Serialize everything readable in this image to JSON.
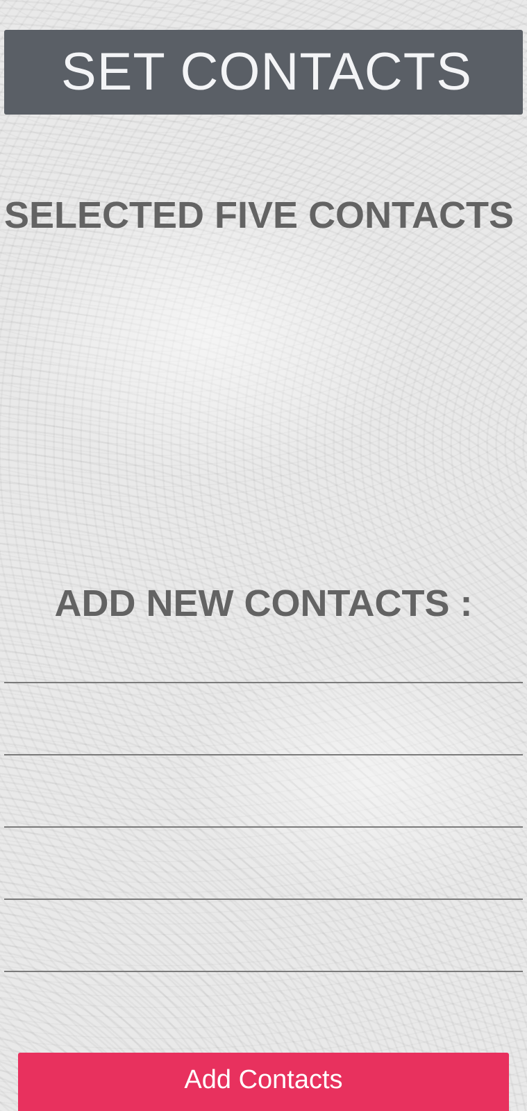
{
  "header": {
    "title": "SET CONTACTS"
  },
  "selected_section": {
    "heading": "SELECTED FIVE CONTACTS"
  },
  "add_section": {
    "heading": "ADD NEW CONTACTS :",
    "fields": [
      {
        "value": "",
        "placeholder": ""
      },
      {
        "value": "",
        "placeholder": ""
      },
      {
        "value": "",
        "placeholder": ""
      },
      {
        "value": "",
        "placeholder": ""
      },
      {
        "value": "",
        "placeholder": ""
      }
    ]
  },
  "actions": {
    "add_button_label": "Add Contacts"
  },
  "colors": {
    "header_bg": "#5a5f66",
    "heading_text": "#636363",
    "button_bg": "#e8315e",
    "button_text": "#ffffff"
  }
}
